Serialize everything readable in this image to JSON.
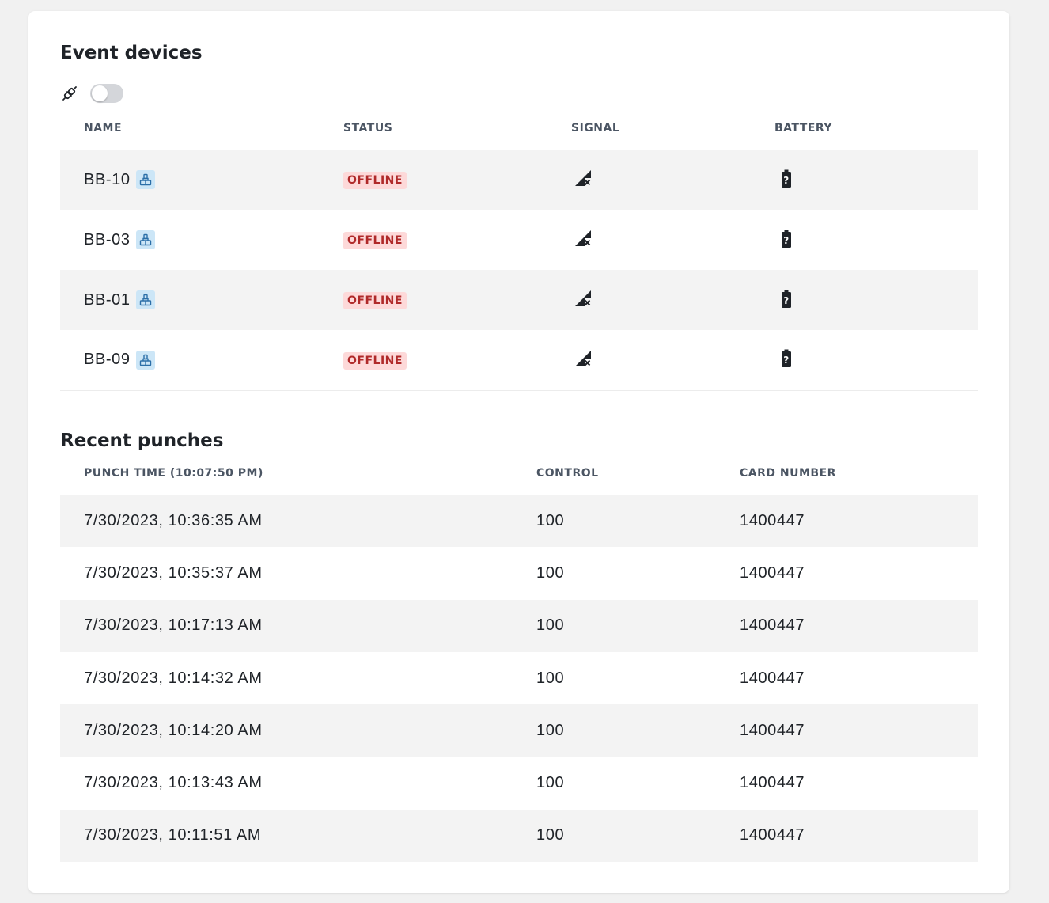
{
  "events": {
    "title": "Event devices",
    "toggle_on": false,
    "columns": {
      "name": "NAME",
      "status": "STATUS",
      "signal": "SIGNAL",
      "battery": "BATTERY"
    },
    "devices": [
      {
        "name": "BB-10",
        "status": "OFFLINE",
        "signal_icon": "signal-off-icon",
        "battery_icon": "battery-unknown-icon"
      },
      {
        "name": "BB-03",
        "status": "OFFLINE",
        "signal_icon": "signal-off-icon",
        "battery_icon": "battery-unknown-icon"
      },
      {
        "name": "BB-01",
        "status": "OFFLINE",
        "signal_icon": "signal-off-icon",
        "battery_icon": "battery-unknown-icon"
      },
      {
        "name": "BB-09",
        "status": "OFFLINE",
        "signal_icon": "signal-off-icon",
        "battery_icon": "battery-unknown-icon"
      }
    ]
  },
  "punches": {
    "title": "Recent punches",
    "columns": {
      "time": "PUNCH TIME (10:07:50 PM)",
      "control": "CONTROL",
      "card": "CARD NUMBER"
    },
    "rows": [
      {
        "time": "7/30/2023, 10:36:35 AM",
        "control": "100",
        "card": "1400447"
      },
      {
        "time": "7/30/2023, 10:35:37 AM",
        "control": "100",
        "card": "1400447"
      },
      {
        "time": "7/30/2023, 10:17:13 AM",
        "control": "100",
        "card": "1400447"
      },
      {
        "time": "7/30/2023, 10:14:32 AM",
        "control": "100",
        "card": "1400447"
      },
      {
        "time": "7/30/2023, 10:14:20 AM",
        "control": "100",
        "card": "1400447"
      },
      {
        "time": "7/30/2023, 10:13:43 AM",
        "control": "100",
        "card": "1400447"
      },
      {
        "time": "7/30/2023, 10:11:51 AM",
        "control": "100",
        "card": "1400447"
      }
    ]
  },
  "colors": {
    "status_offline_bg": "#fdd9d9",
    "status_offline_text": "#b02a2a",
    "device_icon_bg": "#cce6f7",
    "device_icon_fg": "#2b6fa8",
    "row_stripe": "#f3f3f3"
  }
}
